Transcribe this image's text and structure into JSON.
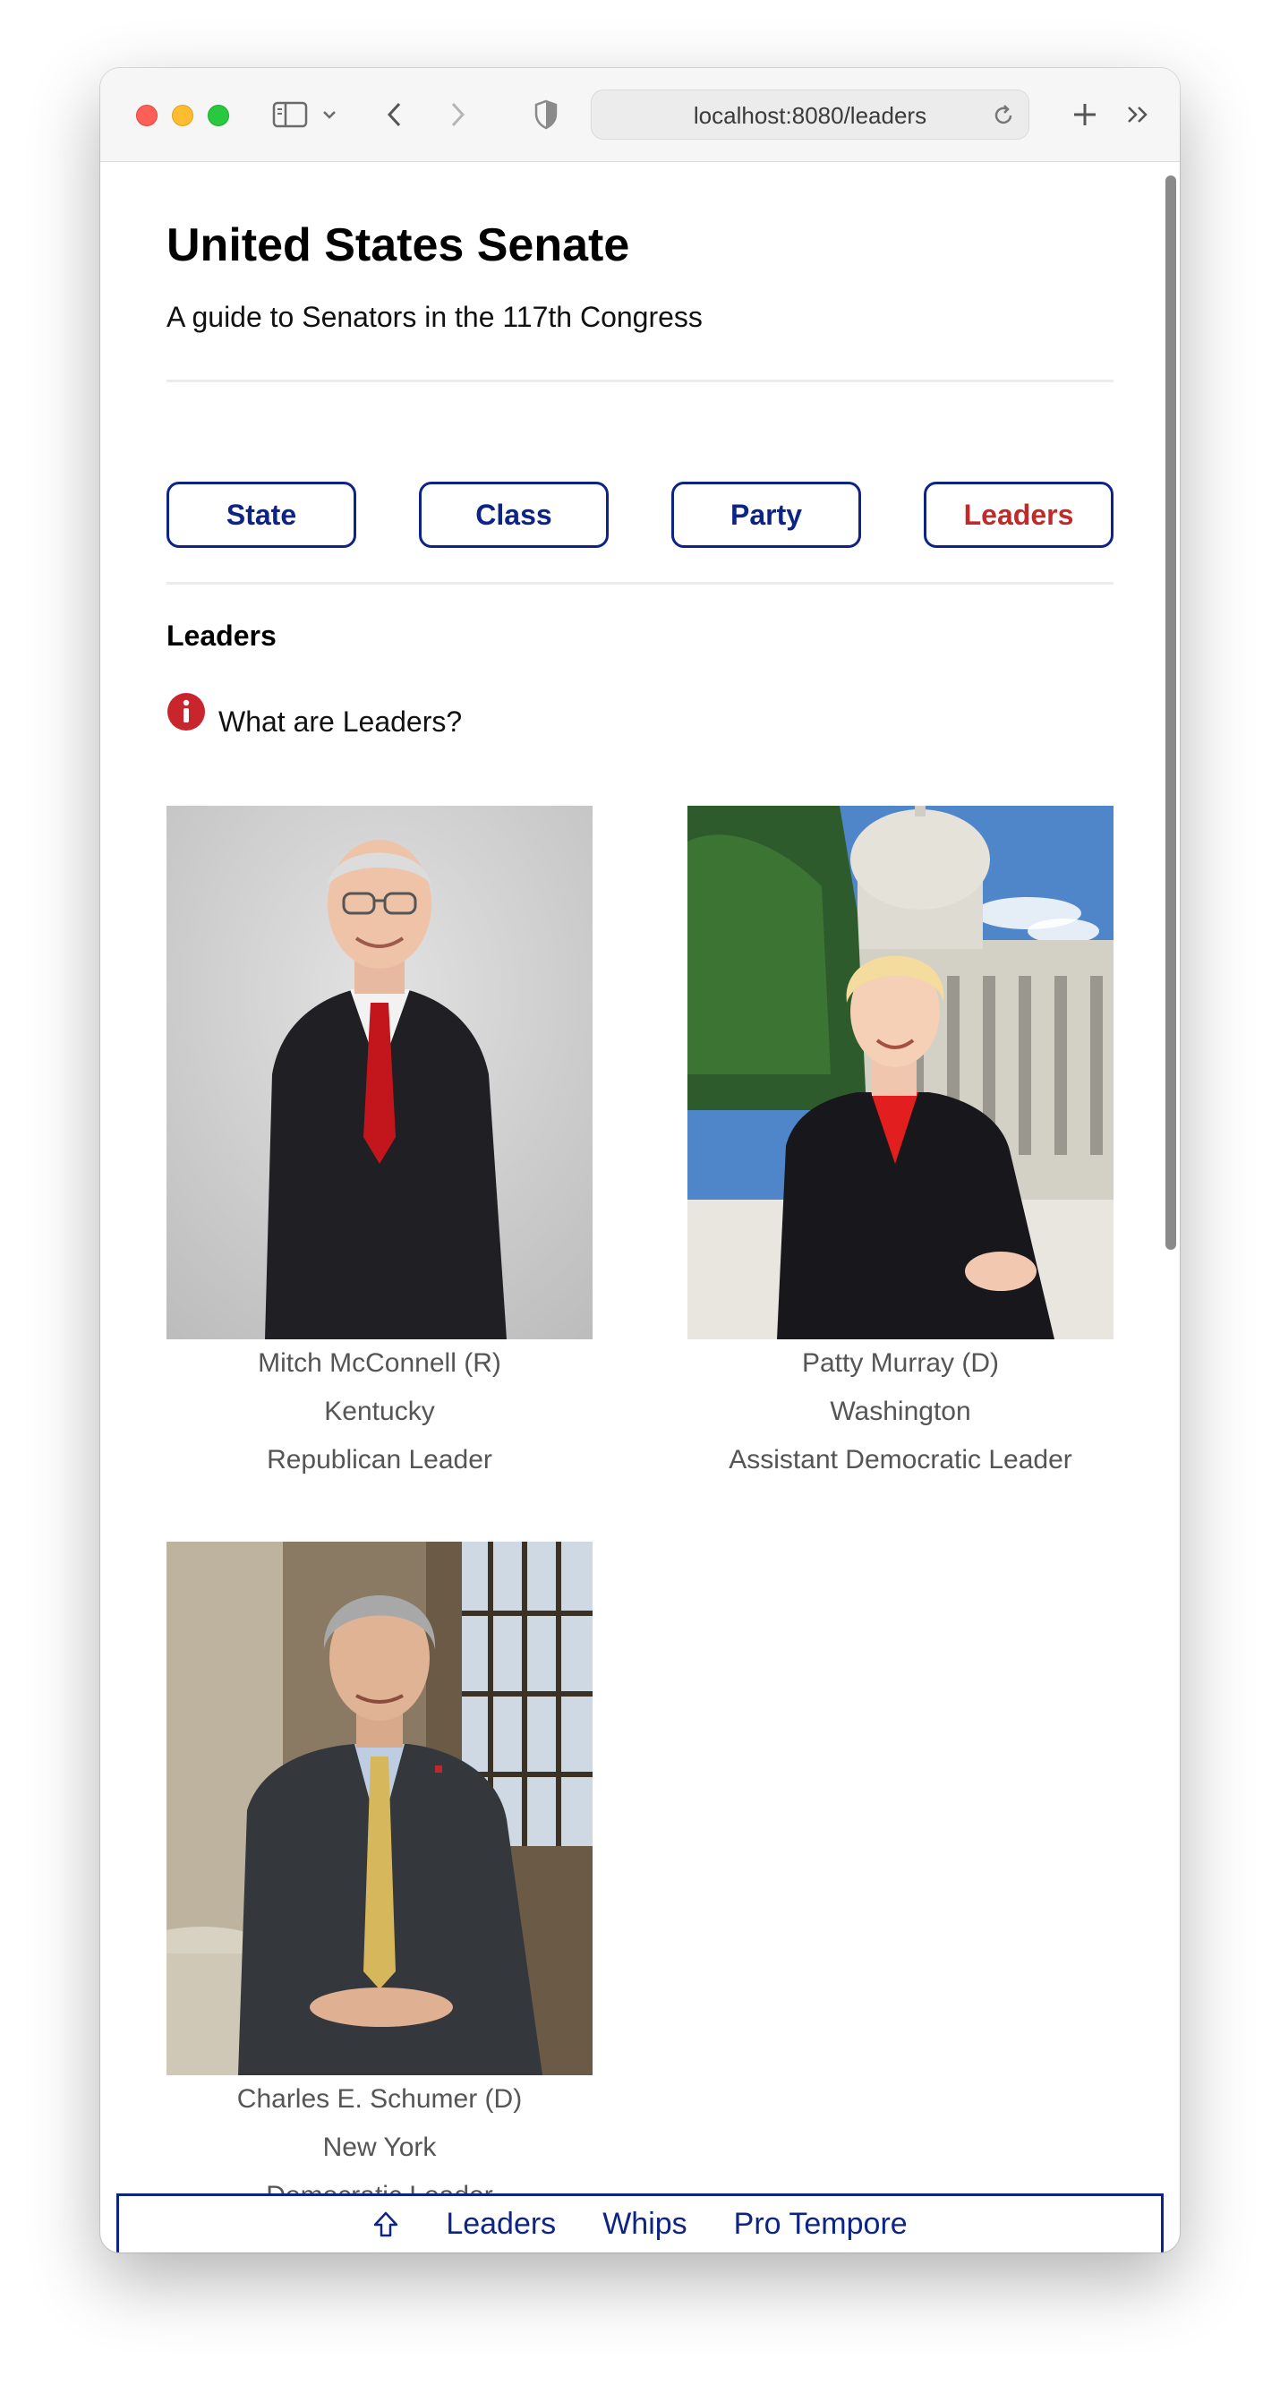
{
  "browser": {
    "url": "localhost:8080/leaders"
  },
  "header": {
    "title": "United States Senate",
    "subtitle": "A guide to Senators in the 117th Congress"
  },
  "nav": {
    "items": [
      {
        "label": "State"
      },
      {
        "label": "Class"
      },
      {
        "label": "Party"
      },
      {
        "label": "Leaders",
        "active": true
      }
    ]
  },
  "section": {
    "title": "Leaders",
    "info_label": "What are Leaders?"
  },
  "senators": [
    {
      "name": "Mitch McConnell (R)",
      "state": "Kentucky",
      "role": "Republican Leader"
    },
    {
      "name": "Patty Murray (D)",
      "state": "Washington",
      "role": "Assistant Democratic Leader"
    },
    {
      "name": "Charles E. Schumer (D)",
      "state": "New York",
      "role": "Democratic Leader"
    }
  ],
  "bottom_nav": {
    "items": [
      {
        "label": "Leaders"
      },
      {
        "label": "Whips"
      },
      {
        "label": "Pro Tempore"
      }
    ]
  },
  "colors": {
    "accent": "#0d2486",
    "active": "#c22a2a"
  }
}
